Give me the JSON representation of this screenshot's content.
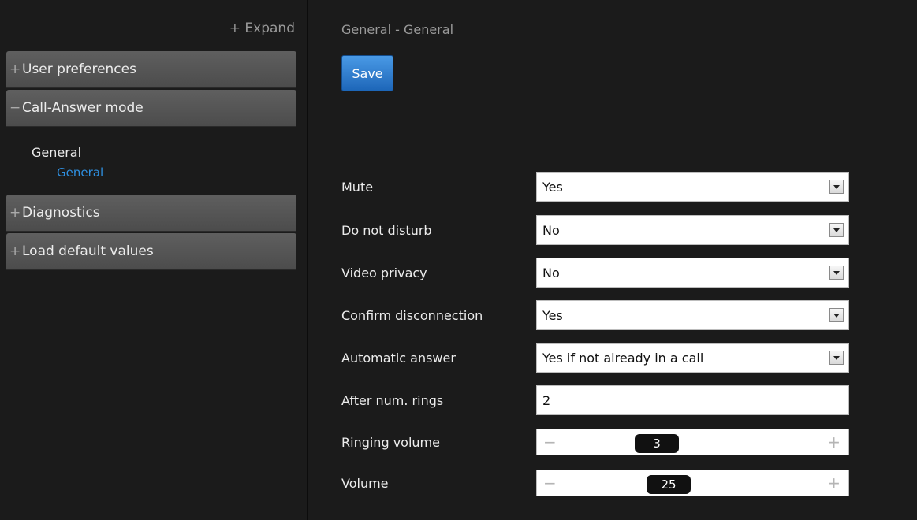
{
  "sidebar": {
    "expand_label": "+ Expand",
    "sections": [
      {
        "sign": "+",
        "label": "User preferences"
      },
      {
        "sign": "−",
        "label": "Call-Answer mode"
      },
      {
        "sign": "+",
        "label": "Diagnostics"
      },
      {
        "sign": "+",
        "label": "Load default values"
      }
    ],
    "subnav": {
      "group": "General",
      "item": "General"
    }
  },
  "main": {
    "breadcrumb": "General - General",
    "save_label": "Save",
    "settings": {
      "mute": {
        "label": "Mute",
        "value": "Yes"
      },
      "dnd": {
        "label": "Do not disturb",
        "value": "No"
      },
      "video_privacy": {
        "label": "Video privacy",
        "value": "No"
      },
      "confirm_disconnection": {
        "label": "Confirm disconnection",
        "value": "Yes"
      },
      "automatic_answer": {
        "label": "Automatic answer",
        "value": "Yes if not already in a call"
      },
      "after_num_rings": {
        "label": "After num. rings",
        "value": "2"
      },
      "ringing_volume": {
        "label": "Ringing volume",
        "value": "3",
        "minus": "−",
        "plus": "+"
      },
      "volume": {
        "label": "Volume",
        "value": "25",
        "minus": "−",
        "plus": "+"
      }
    }
  },
  "colors": {
    "accent": "#2e8fe0",
    "save_button": "#2a78d0",
    "background": "#1b1b1b",
    "accordion": "#565656"
  }
}
